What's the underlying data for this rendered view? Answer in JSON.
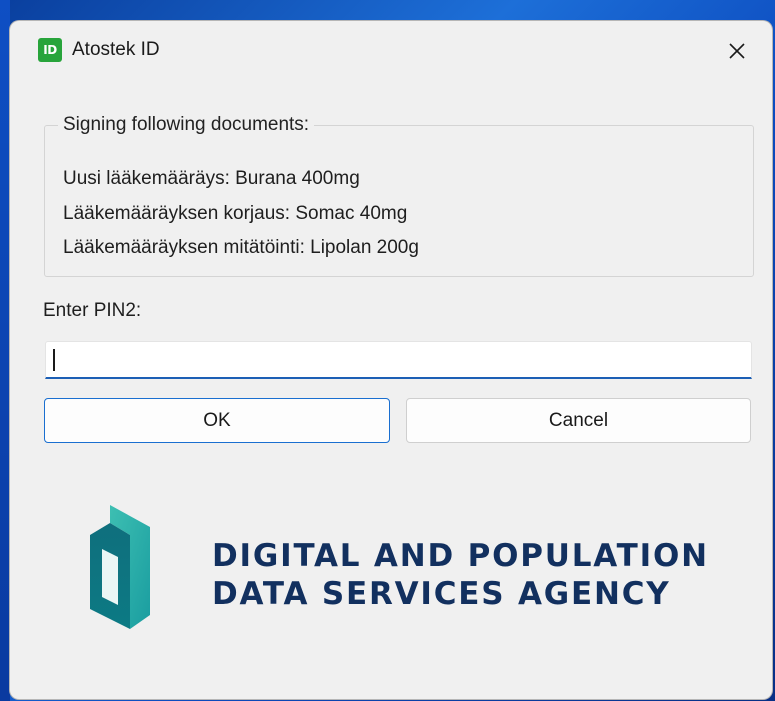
{
  "window": {
    "title": "Atostek ID",
    "app_icon_text": "ID",
    "close_glyph": "✕"
  },
  "documents_group": {
    "legend": "Signing following documents:",
    "items": [
      "Uusi lääkemääräys: Burana 400mg",
      "Lääkemääräyksen korjaus: Somac 40mg",
      "Lääkemääräyksen mitätöinti: Lipolan 200g"
    ]
  },
  "pin": {
    "label": "Enter PIN2:",
    "value": ""
  },
  "buttons": {
    "ok_label": "OK",
    "cancel_label": "Cancel"
  },
  "branding": {
    "line1": "DIGITAL AND POPULATION",
    "line2": "DATA SERVICES AGENCY"
  },
  "colors": {
    "app_icon": "#27a43b",
    "accent": "#1a6fd0",
    "agency_text": "#12305f",
    "logo_teal_dark": "#0c7a84",
    "logo_teal_light": "#3dbfb2"
  }
}
